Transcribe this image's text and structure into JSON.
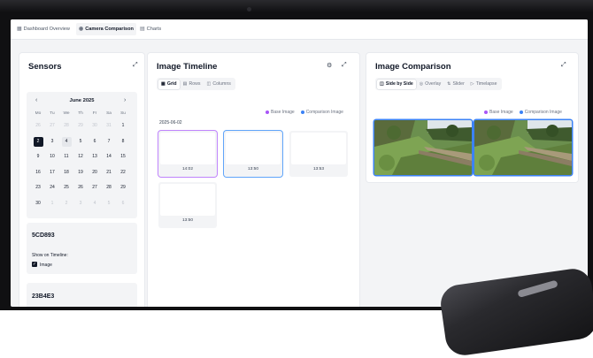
{
  "tabs": [
    {
      "label": "Dashboard Overview",
      "icon": "dashboard-icon"
    },
    {
      "label": "Camera Comparison",
      "icon": "camera-icon",
      "active": true
    },
    {
      "label": "Charts",
      "icon": "chart-icon"
    }
  ],
  "sensors": {
    "title": "Sensors",
    "calendar": {
      "month": "June 2025",
      "weekdays": [
        "Mo",
        "Tu",
        "We",
        "Th",
        "Fr",
        "Sa",
        "Su"
      ],
      "weeks": [
        [
          "26",
          "27",
          "28",
          "29",
          "30",
          "31",
          "1"
        ],
        [
          "2",
          "3",
          "4",
          "5",
          "6",
          "7",
          "8"
        ],
        [
          "9",
          "10",
          "11",
          "12",
          "13",
          "14",
          "15"
        ],
        [
          "16",
          "17",
          "18",
          "19",
          "20",
          "21",
          "22"
        ],
        [
          "23",
          "24",
          "25",
          "26",
          "27",
          "28",
          "29"
        ],
        [
          "30",
          "1",
          "2",
          "3",
          "4",
          "5",
          "6"
        ]
      ],
      "selected_day": "2",
      "highlighted_day": "4"
    },
    "cards": [
      {
        "id": "5CD893",
        "show_label": "Show on Timeline:",
        "checkbox_label": "Image",
        "checked": true
      },
      {
        "id": "23B4E3"
      }
    ]
  },
  "timeline": {
    "title": "Image Timeline",
    "views": [
      {
        "label": "Grid",
        "icon": "grid-icon",
        "active": true
      },
      {
        "label": "Rows",
        "icon": "rows-icon"
      },
      {
        "label": "Columns",
        "icon": "columns-icon"
      }
    ],
    "legend": [
      {
        "label": "Base Image",
        "color": "#a855f7"
      },
      {
        "label": "Comparison Image",
        "color": "#3b82f6"
      }
    ],
    "date": "2025-06-02",
    "thumbnails": [
      {
        "time": "14:02",
        "role": "base",
        "border": "#c084fc"
      },
      {
        "time": "13:50",
        "role": "comparison",
        "border": "#60a5fa"
      },
      {
        "time": "13:53",
        "role": "none",
        "border": "#e5e7eb"
      },
      {
        "time": "13:50",
        "role": "none",
        "border": "#e5e7eb"
      }
    ]
  },
  "comparison": {
    "title": "Image Comparison",
    "modes": [
      {
        "label": "Side by Side",
        "icon": "side-by-side-icon",
        "active": true
      },
      {
        "label": "Overlay",
        "icon": "overlay-icon"
      },
      {
        "label": "Slider",
        "icon": "slider-icon"
      },
      {
        "label": "Timelapse",
        "icon": "play-icon"
      }
    ],
    "legend": [
      {
        "label": "Base Image",
        "color": "#a855f7"
      },
      {
        "label": "Comparison Image",
        "color": "#3b82f6"
      }
    ]
  }
}
